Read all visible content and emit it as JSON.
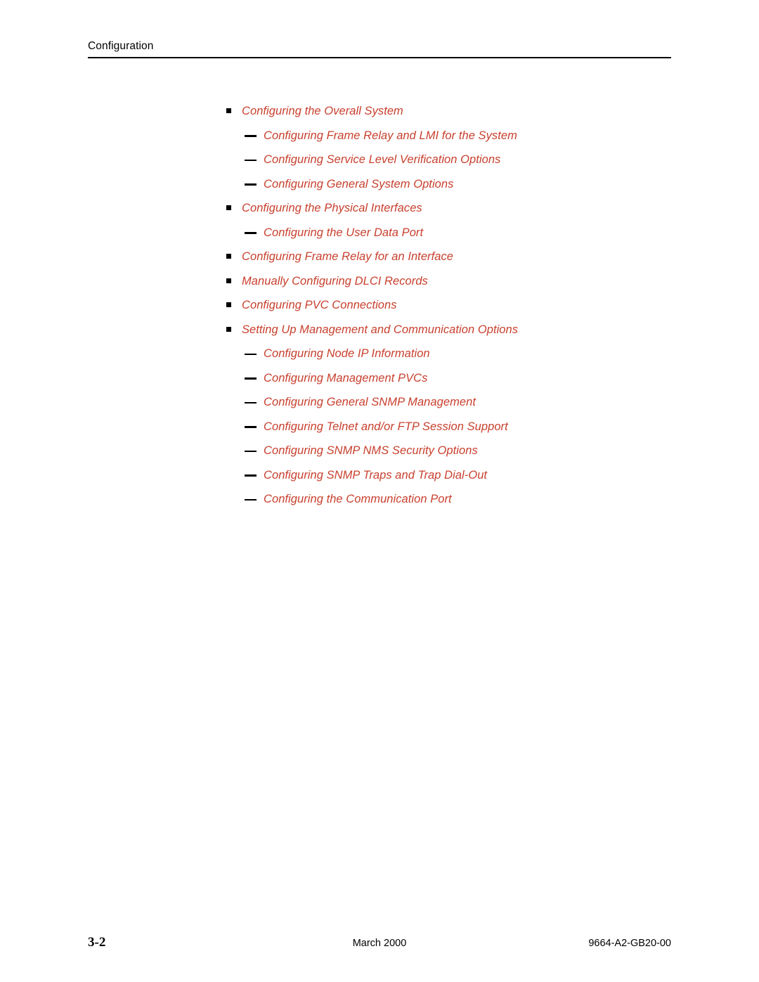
{
  "header": {
    "title": "Configuration"
  },
  "colors": {
    "link_red": "#C8402E",
    "text_black": "#000000",
    "page_background": "#FFFFFF"
  },
  "toc": {
    "items": [
      {
        "level": 1,
        "marker": "square-bullet",
        "label": "Configuring the Overall System"
      },
      {
        "level": 2,
        "marker": "em-dash",
        "label": "Configuring Frame Relay and LMI for the System"
      },
      {
        "level": 2,
        "marker": "em-dash",
        "label": "Configuring Service Level Verification Options"
      },
      {
        "level": 2,
        "marker": "em-dash",
        "label": "Configuring General System Options"
      },
      {
        "level": 1,
        "marker": "square-bullet",
        "label": "Configuring the Physical Interfaces"
      },
      {
        "level": 2,
        "marker": "em-dash",
        "label": "Configuring the User Data Port"
      },
      {
        "level": 1,
        "marker": "square-bullet",
        "label": "Configuring Frame Relay for an Interface"
      },
      {
        "level": 1,
        "marker": "square-bullet",
        "label": "Manually Configuring DLCI Records"
      },
      {
        "level": 1,
        "marker": "square-bullet",
        "label": "Configuring PVC Connections"
      },
      {
        "level": 1,
        "marker": "square-bullet",
        "label": "Setting Up Management and Communication Options"
      },
      {
        "level": 2,
        "marker": "em-dash",
        "label": "Configuring Node IP Information"
      },
      {
        "level": 2,
        "marker": "em-dash",
        "label": "Configuring Management PVCs"
      },
      {
        "level": 2,
        "marker": "em-dash",
        "label": "Configuring General SNMP Management"
      },
      {
        "level": 2,
        "marker": "em-dash",
        "label": "Configuring Telnet and/or FTP Session Support"
      },
      {
        "level": 2,
        "marker": "em-dash",
        "label": "Configuring SNMP NMS Security Options"
      },
      {
        "level": 2,
        "marker": "em-dash",
        "label": "Configuring SNMP Traps and Trap Dial-Out"
      },
      {
        "level": 2,
        "marker": "em-dash",
        "label": "Configuring the Communication Port"
      }
    ]
  },
  "footer": {
    "page_number": "3-2",
    "date": "March 2000",
    "document_id": "9664-A2-GB20-00"
  }
}
